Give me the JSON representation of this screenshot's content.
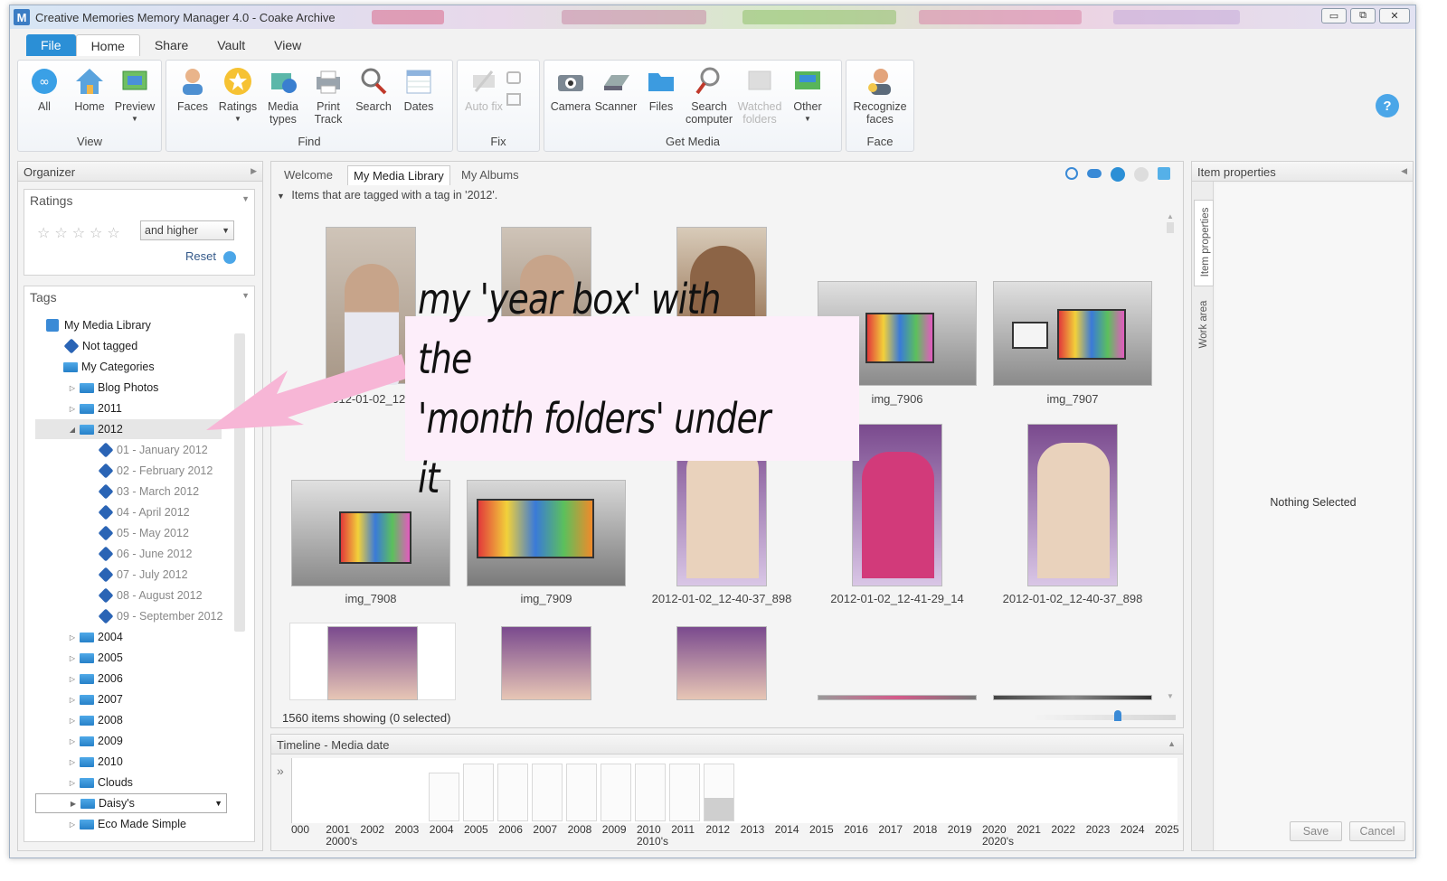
{
  "window": {
    "title": "Creative Memories Memory Manager 4.0 - Coake Archive",
    "logo_letter": "M",
    "controls": {
      "minimize": "▭",
      "restore": "⧉",
      "close": "✕"
    }
  },
  "ribbon": {
    "tabs": [
      "File",
      "Home",
      "Share",
      "Vault",
      "View"
    ],
    "groups": [
      {
        "label": "View",
        "buttons": [
          "All",
          "Home",
          "Preview"
        ]
      },
      {
        "label": "Find",
        "buttons": [
          "Faces",
          "Ratings",
          "Media types",
          "Print Track",
          "Search",
          "Dates"
        ]
      },
      {
        "label": "Fix",
        "buttons": [
          "Auto fix"
        ]
      },
      {
        "label": "Get Media",
        "buttons": [
          "Camera",
          "Scanner",
          "Files",
          "Search computer",
          "Watched folders",
          "Other"
        ]
      },
      {
        "label": "Face",
        "buttons": [
          "Recognize faces"
        ]
      }
    ],
    "help": "?"
  },
  "organizer": {
    "title": "Organizer",
    "ratings": {
      "title": "Ratings",
      "filter": "and higher",
      "reset": "Reset"
    },
    "tags": {
      "title": "Tags",
      "root": "My Media Library",
      "not_tagged": "Not tagged",
      "categories": "My Categories",
      "folders_before": [
        "Blog Photos",
        "2011",
        "2012"
      ],
      "months": [
        "01 - January 2012",
        "02 - February 2012",
        "03 - March 2012",
        "04 - April 2012",
        "05 - May 2012",
        "06 - June 2012",
        "07 - July 2012",
        "08 - August 2012",
        "09 - September 2012"
      ],
      "folders_after": [
        "2004",
        "2005",
        "2006",
        "2007",
        "2008",
        "2009",
        "2010",
        "Clouds",
        "Daisy's",
        "Eco Made Simple"
      ]
    }
  },
  "center": {
    "tabs": [
      "Welcome",
      "My Media Library",
      "My Albums"
    ],
    "filter_text": "Items that are tagged with a tag in '2012'.",
    "row1_captions": [
      "2012-01-02_12-39-22",
      "img_7906",
      "img_7907"
    ],
    "row2_captions": [
      "img_7908",
      "img_7909",
      "2012-01-02_12-40-37_898",
      "2012-01-02_12-41-29_14",
      "2012-01-02_12-40-37_898"
    ],
    "status": "1560 items showing  (0 selected)"
  },
  "timeline": {
    "title": "Timeline - Media date",
    "years": [
      "000",
      "2001",
      "2002",
      "2003",
      "2004",
      "2005",
      "2006",
      "2007",
      "2008",
      "2009",
      "2010",
      "2011",
      "2012",
      "2013",
      "2014",
      "2015",
      "2016",
      "2017",
      "2018",
      "2019",
      "2020",
      "2021",
      "2022",
      "2023",
      "2024",
      "2025"
    ],
    "decades": [
      "2000's",
      "2010's",
      "2020's"
    ]
  },
  "item_properties": {
    "title": "Item properties",
    "side_tabs": [
      "Item properties",
      "Work area"
    ],
    "empty": "Nothing Selected",
    "save": "Save",
    "cancel": "Cancel"
  },
  "annotation": {
    "line1": "my 'year box' with the",
    "line2": "'month folders' under it"
  },
  "colors": {
    "accent": "#2b8fd6",
    "annotation_bg": "#fdeefa",
    "arrow": "#f7b6d6"
  }
}
